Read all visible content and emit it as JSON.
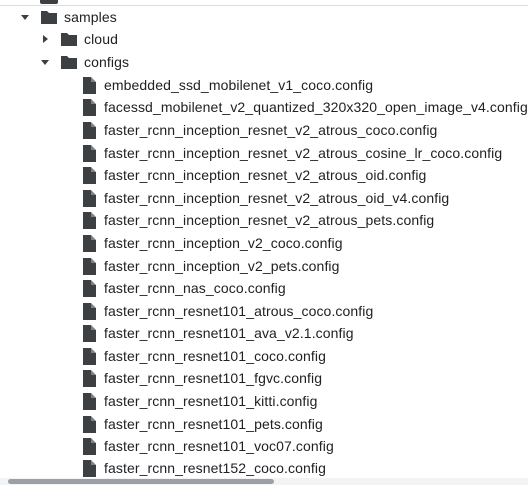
{
  "tree": {
    "samples": {
      "label": "samples",
      "icon": "folder-icon",
      "expanded": true
    },
    "cloud": {
      "label": "cloud",
      "icon": "folder-icon",
      "expanded": false
    },
    "configs": {
      "label": "configs",
      "icon": "folder-icon",
      "expanded": true
    },
    "files": [
      "embedded_ssd_mobilenet_v1_coco.config",
      "facessd_mobilenet_v2_quantized_320x320_open_image_v4.config",
      "faster_rcnn_inception_resnet_v2_atrous_coco.config",
      "faster_rcnn_inception_resnet_v2_atrous_cosine_lr_coco.config",
      "faster_rcnn_inception_resnet_v2_atrous_oid.config",
      "faster_rcnn_inception_resnet_v2_atrous_oid_v4.config",
      "faster_rcnn_inception_resnet_v2_atrous_pets.config",
      "faster_rcnn_inception_v2_coco.config",
      "faster_rcnn_inception_v2_pets.config",
      "faster_rcnn_nas_coco.config",
      "faster_rcnn_resnet101_atrous_coco.config",
      "faster_rcnn_resnet101_ava_v2.1.config",
      "faster_rcnn_resnet101_coco.config",
      "faster_rcnn_resnet101_fgvc.config",
      "faster_rcnn_resnet101_kitti.config",
      "faster_rcnn_resnet101_pets.config",
      "faster_rcnn_resnet101_voc07.config",
      "faster_rcnn_resnet152_coco.config"
    ]
  },
  "colors": {
    "icon": "#3c4043",
    "text": "#202124",
    "scrollbar_track": "#f1f3f4",
    "scrollbar_thumb": "#9aa0a6"
  }
}
